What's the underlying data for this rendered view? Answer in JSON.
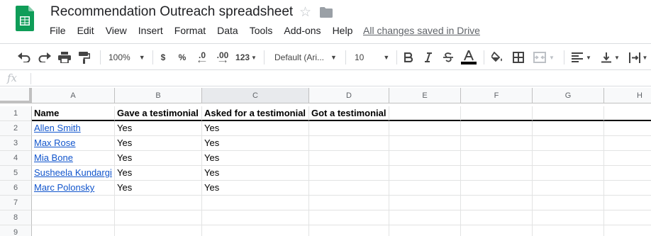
{
  "app": {
    "title": "Recommendation Outreach spreadsheet",
    "saved_status": "All changes saved in Drive"
  },
  "menu": [
    "File",
    "Edit",
    "View",
    "Insert",
    "Format",
    "Data",
    "Tools",
    "Add-ons",
    "Help"
  ],
  "toolbar": {
    "zoom": "100%",
    "currency": "$",
    "percent": "%",
    "decrease_decimals": ".0",
    "increase_decimals": ".00",
    "more_formats": "123",
    "font": "Default (Ari...",
    "font_size": "10"
  },
  "formula_bar": {
    "label": "fx",
    "value": ""
  },
  "columns": [
    "A",
    "B",
    "C",
    "D",
    "E",
    "F",
    "G",
    "H"
  ],
  "selected_column": "C",
  "rows": [
    "1",
    "2",
    "3",
    "4",
    "5",
    "6",
    "7",
    "8",
    "9"
  ],
  "sheet": {
    "header": [
      "Name",
      "Gave a testimonial",
      "Asked for a testimonial",
      "Got a testimonial"
    ],
    "data": [
      [
        "Allen Smith",
        "Yes",
        "Yes",
        ""
      ],
      [
        "Max Rose",
        "Yes",
        "Yes",
        ""
      ],
      [
        "Mia Bone",
        "Yes",
        "Yes",
        ""
      ],
      [
        "Susheela Kundargi",
        "Yes",
        "Yes",
        ""
      ],
      [
        "Marc Polonsky",
        "Yes",
        "Yes",
        ""
      ]
    ]
  },
  "colors": {
    "sheets_green": "#0f9d58",
    "link": "#1155cc",
    "header_bg": "#f8f9fa",
    "selected_header_bg": "#e8eaed"
  }
}
